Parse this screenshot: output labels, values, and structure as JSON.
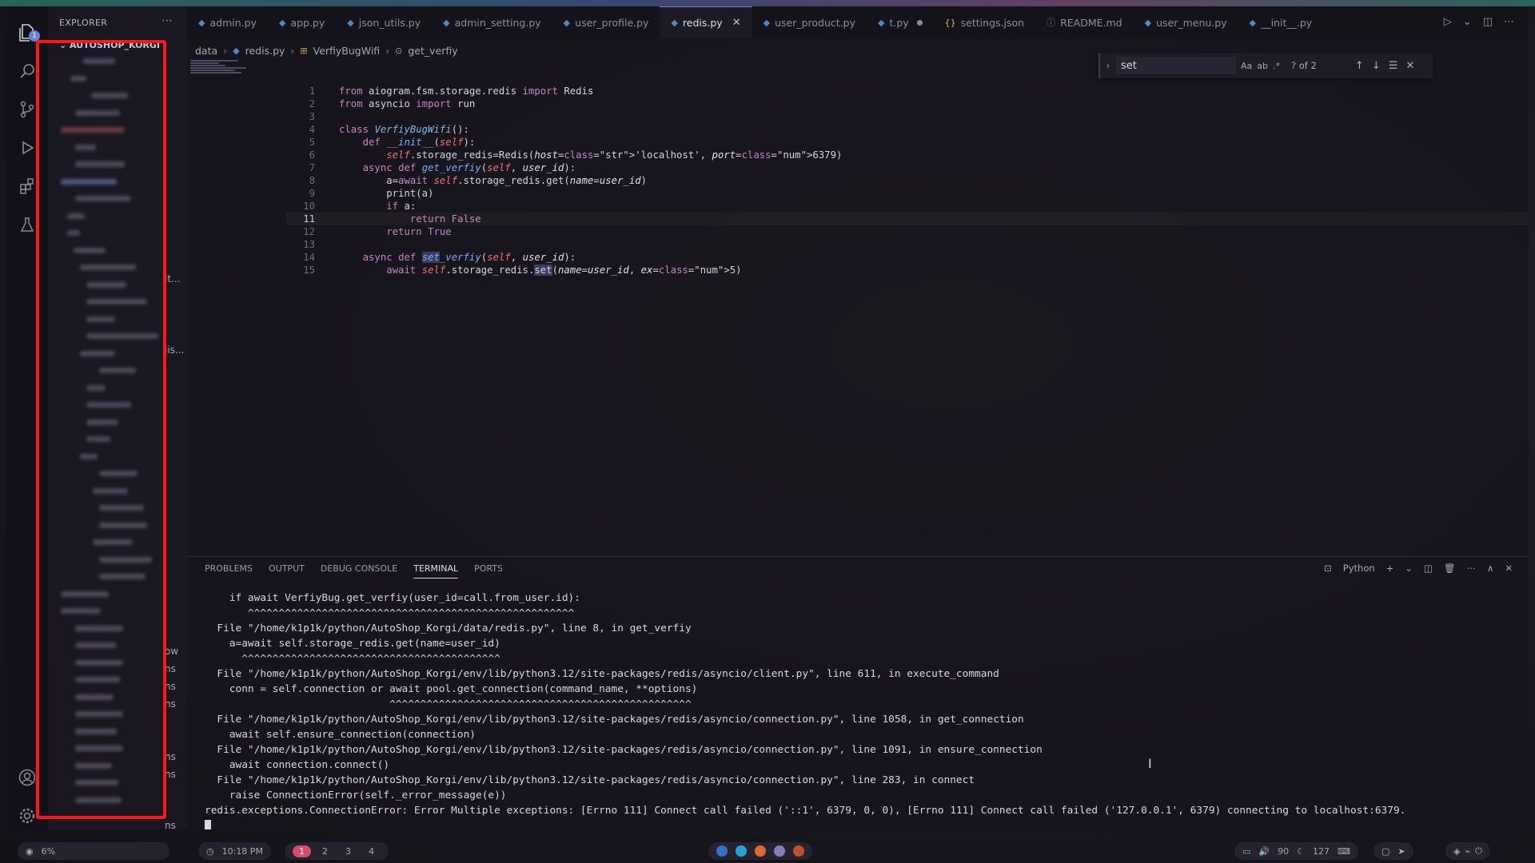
{
  "sidebar": {
    "title": "EXPLORER",
    "project": "AUTOSHOP_KORGI",
    "more_icon": "ellipsis-icon",
    "fragments": [
      "it...",
      "lis...",
      "ow",
      "ns",
      "ns",
      "ns",
      "ns",
      "ns",
      "ns"
    ]
  },
  "activity": {
    "badge": "1",
    "icons": [
      "files-icon",
      "search-icon",
      "source-control-icon",
      "run-debug-icon",
      "extensions-icon",
      "testing-icon",
      "account-icon",
      "gear-icon"
    ]
  },
  "tabs": [
    {
      "label": "admin.py",
      "icon": "python-icon"
    },
    {
      "label": "app.py",
      "icon": "python-icon"
    },
    {
      "label": "json_utils.py",
      "icon": "python-icon"
    },
    {
      "label": "admin_setting.py",
      "icon": "python-icon"
    },
    {
      "label": "user_profile.py",
      "icon": "python-icon"
    },
    {
      "label": "redis.py",
      "icon": "python-icon",
      "active": true
    },
    {
      "label": "user_product.py",
      "icon": "python-icon"
    },
    {
      "label": "t.py",
      "icon": "python-icon"
    },
    {
      "label": "settings.json",
      "icon": "json-icon"
    },
    {
      "label": "README.md",
      "icon": "info-icon"
    },
    {
      "label": "user_menu.py",
      "icon": "python-icon"
    },
    {
      "label": "__init__.py",
      "icon": "python-icon"
    }
  ],
  "breadcrumb": [
    "data",
    "redis.py",
    "VerfiyBugWifi",
    "get_verfiy"
  ],
  "find": {
    "value": "set",
    "options": [
      "Aa",
      "ab",
      ".*"
    ],
    "count": "? of 2"
  },
  "code": {
    "current_line": 11,
    "lines": [
      "from aiogram.fsm.storage.redis import Redis",
      "from asyncio import run",
      "",
      "class VerfiyBugWifi():",
      "    def __init__(self):",
      "        self.storage_redis=Redis(host='localhost', port=6379)",
      "    async def get_verfiy(self, user_id):",
      "        a=await self.storage_redis.get(name=user_id)",
      "        print(a)",
      "        if a:",
      "            return False",
      "        return True",
      "",
      "    async def set_verfiy(self, user_id):",
      "        await self.storage_redis.set(name=user_id, ex=5)"
    ]
  },
  "panel": {
    "tabs": [
      "PROBLEMS",
      "OUTPUT",
      "DEBUG CONSOLE",
      "TERMINAL",
      "PORTS"
    ],
    "active_tab": "TERMINAL",
    "shell": "Python",
    "terminal_lines": [
      "    if await VerfiyBug.get_verfiy(user_id=call.from_user.id):",
      "       ^^^^^^^^^^^^^^^^^^^^^^^^^^^^^^^^^^^^^^^^^^^^^^^^^^^^^",
      "  File \"/home/k1p1k/python/AutoShop_Korgi/data/redis.py\", line 8, in get_verfiy",
      "    a=await self.storage_redis.get(name=user_id)",
      "      ^^^^^^^^^^^^^^^^^^^^^^^^^^^^^^^^^^^^^^^^^^",
      "  File \"/home/k1p1k/python/AutoShop_Korgi/env/lib/python3.12/site-packages/redis/asyncio/client.py\", line 611, in execute_command",
      "    conn = self.connection or await pool.get_connection(command_name, **options)",
      "                              ^^^^^^^^^^^^^^^^^^^^^^^^^^^^^^^^^^^^^^^^^^^^^^^^^",
      "  File \"/home/k1p1k/python/AutoShop_Korgi/env/lib/python3.12/site-packages/redis/asyncio/connection.py\", line 1058, in get_connection",
      "    await self.ensure_connection(connection)",
      "  File \"/home/k1p1k/python/AutoShop_Korgi/env/lib/python3.12/site-packages/redis/asyncio/connection.py\", line 1091, in ensure_connection",
      "    await connection.connect()",
      "  File \"/home/k1p1k/python/AutoShop_Korgi/env/lib/python3.12/site-packages/redis/asyncio/connection.py\", line 283, in connect",
      "    raise ConnectionError(self._error_message(e))",
      "redis.exceptions.ConnectionError: Error Multiple exceptions: [Errno 111] Connect call failed ('::1', 6379, 0, 0), [Errno 111] Connect call failed ('127.0.0.1', 6379) connecting to localhost:6379."
    ]
  },
  "bottombar": {
    "cpu": "6%",
    "clock": "10:18 PM",
    "workspaces": [
      "1",
      "2",
      "3",
      "4"
    ],
    "active_workspace": "1",
    "volume": "90",
    "brightness": "127"
  },
  "colors": {
    "accent": "#7b7bd8",
    "annotation_box": "#ff1616",
    "workspace_active": "#d34e6a"
  }
}
